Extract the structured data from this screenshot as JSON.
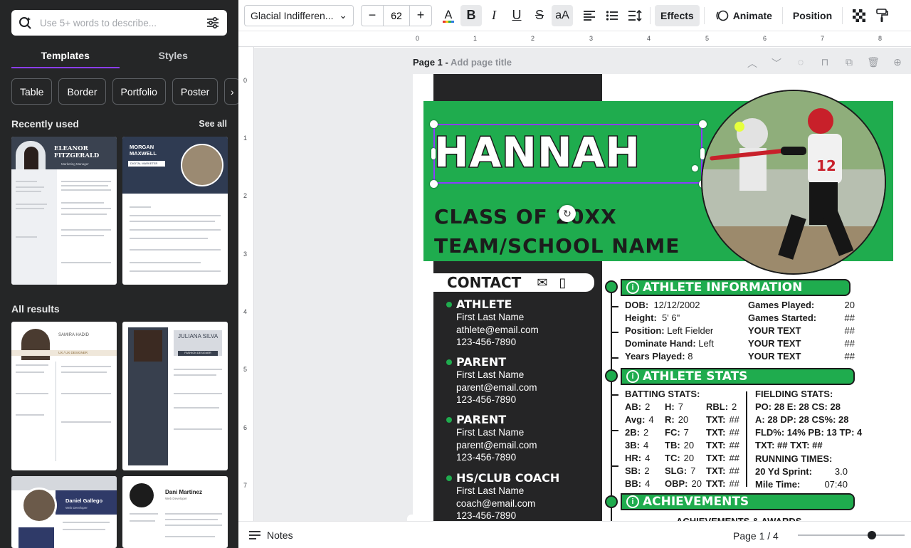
{
  "left_panel": {
    "search_placeholder": "Use 5+ words to describe...",
    "tabs": [
      "Templates",
      "Styles"
    ],
    "chips": [
      "Table",
      "Border",
      "Portfolio",
      "Poster"
    ],
    "recently_used": {
      "title": "Recently used",
      "see_all": "See all"
    },
    "all_results": {
      "title": "All results"
    },
    "thumbs": [
      {
        "name": "ELEANOR FITZGERALD",
        "role": "Marketing Manager"
      },
      {
        "name": "MORGAN MAXWELL",
        "role": "DIGITAL MARKETER"
      },
      {
        "name": "SAMIRA HADID",
        "role": "UX / UX DESIGNER"
      },
      {
        "name": "JULIANA SILVA",
        "role": "FASHION DESIGNER"
      },
      {
        "name": "Daniel Gallego",
        "role": "Web Developer"
      },
      {
        "name": "Dani Martinez",
        "role": "Web Developer"
      }
    ]
  },
  "toolbar": {
    "font": "Glacial Indifferen...",
    "font_size": "62",
    "effects": "Effects",
    "animate": "Animate",
    "position": "Position"
  },
  "ruler_top": [
    "0",
    "1",
    "2",
    "3",
    "4",
    "5",
    "6",
    "7",
    "8"
  ],
  "ruler_left": [
    "0",
    "1",
    "2",
    "3",
    "4",
    "5",
    "6",
    "7"
  ],
  "page": {
    "label": "Page 1 - ",
    "add_title": "Add page title"
  },
  "doc": {
    "name": "HANNAH",
    "class_of": "CLASS OF 20XX",
    "team": "TEAM/SCHOOL NAME",
    "contact": {
      "label": "CONTACT",
      "groups": [
        {
          "head": "ATHLETE",
          "lines": [
            "First Last Name",
            "athlete@email.com",
            "123-456-7890"
          ]
        },
        {
          "head": "PARENT",
          "lines": [
            "First Last Name",
            "parent@email.com",
            "123-456-7890"
          ]
        },
        {
          "head": "PARENT",
          "lines": [
            "First Last Name",
            "parent@email.com",
            "123-456-7890"
          ]
        },
        {
          "head": "HS/CLUB COACH",
          "lines": [
            "First Last Name",
            "coach@email.com",
            "123-456-7890"
          ]
        }
      ]
    },
    "sections": {
      "info": "ATHLETE INFORMATION",
      "stats": "ATHLETE STATS",
      "achievements": "ACHIEVEMENTS"
    },
    "athlete_info_left": [
      [
        "DOB:",
        "12/12/2002"
      ],
      [
        "Height:",
        "5' 6\""
      ],
      [
        "Position:",
        "Left Fielder"
      ],
      [
        "Dominate Hand:",
        "Left"
      ],
      [
        "Years Played:",
        "8"
      ]
    ],
    "athlete_info_right": [
      [
        "Games Played:",
        "20"
      ],
      [
        "Games Started:",
        "##"
      ],
      [
        "YOUR TEXT",
        "##"
      ],
      [
        "YOUR TEXT",
        "##"
      ],
      [
        "YOUR TEXT",
        "##"
      ]
    ],
    "batting_title": "BATTING STATS:",
    "batting": [
      [
        "AB:",
        "2",
        "H:",
        "7",
        "RBL:",
        "2"
      ],
      [
        "Avg:",
        "4",
        "R:",
        "20",
        "TXT:",
        "##"
      ],
      [
        "2B:",
        "2",
        "FC:",
        "7",
        "TXT:",
        "##"
      ],
      [
        "3B:",
        "4",
        "TB:",
        "20",
        "TXT:",
        "##"
      ],
      [
        "HR:",
        "4",
        "TC:",
        "20",
        "TXT:",
        "##"
      ],
      [
        "SB:",
        "2",
        "SLG:",
        "7",
        "TXT:",
        "##"
      ],
      [
        "BB:",
        "4",
        "OBP:",
        "20",
        "TXT:",
        "##"
      ]
    ],
    "fielding_title": "FIELDING STATS:",
    "fielding": [
      "PO: 28  E:  28  CS: 28",
      "A:   28  DP: 28  CS%: 28",
      "FLD%: 14%  PB: 13  TP: 4",
      "TXT: ##  TXT: ##"
    ],
    "running_title": "RUNNING TIMES:",
    "running": [
      [
        "20 Yd Sprint:",
        "3.0"
      ],
      [
        "Mile Time:",
        "07:40"
      ]
    ],
    "achievements_sub": "ACHIEVEMENTS & AWARDS"
  },
  "bottom": {
    "notes": "Notes",
    "pager": "Page 1 / 4"
  }
}
